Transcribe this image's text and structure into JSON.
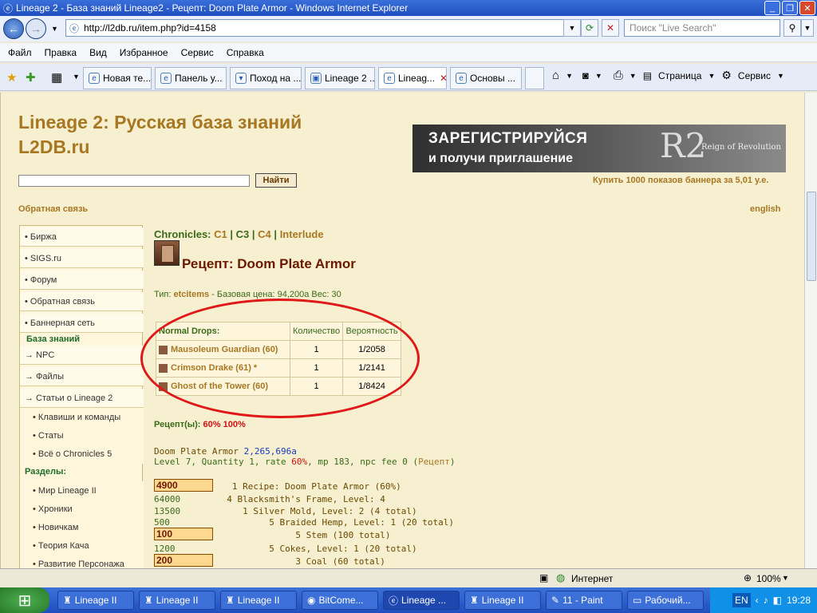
{
  "window": {
    "title": "Lineage 2 - База знаний Lineage2 - Рецепт: Doom Plate Armor - Windows Internet Explorer"
  },
  "address": {
    "url": "http://l2db.ru/item.php?id=4158",
    "search_placeholder": "Поиск \"Live Search\""
  },
  "menu": [
    "Файл",
    "Правка",
    "Вид",
    "Избранное",
    "Сервис",
    "Справка"
  ],
  "tabs": [
    "Новая те...",
    "Панель у...",
    "Поход на ...",
    "Lineage 2 ...",
    "Lineag...",
    "Основы ..."
  ],
  "commands": {
    "page": "Страница",
    "tools": "Сервис"
  },
  "site": {
    "title_line1": "Lineage 2: Русская база знаний",
    "title_line2": "L2DB.ru",
    "search_button": "Найти",
    "feedback": "Обратная связь",
    "english": "english",
    "banner_line1": "ЗАРЕГИСТРИРУЙСЯ",
    "banner_line2": "и получи приглашение",
    "banner_logo": "R2",
    "banner_logo_text": "Reign of Revolution",
    "buy_banner": "Купить 1000 показов баннера за 5,01 у.е."
  },
  "sidebar": {
    "top_items": [
      "• Биржа",
      "• SIGS.ru",
      "• Форум",
      "• Обратная связь",
      "• Баннерная сеть"
    ],
    "kb_heading": "База знаний",
    "kb_items": [
      "→  NPC",
      "→  Файлы",
      "→  Статьи о Lineage 2"
    ],
    "sub_items": [
      "• Клавиши и команды",
      "• Статы",
      "• Всё о Chronicles 5"
    ],
    "sections_heading": "Разделы:",
    "section_items": [
      "• Мир Lineage II",
      "• Хроники",
      "• Новичкам",
      "• Теория Кача",
      "• Развитие Персонажа"
    ]
  },
  "item": {
    "chronicles_label": "Chronicles:",
    "chronicles": [
      "C1",
      "C3",
      "C4",
      "Interlude"
    ],
    "chron_sep": "|",
    "title": "Рецепт: Doom Plate Armor",
    "type_label": "Тип:",
    "type_value": "etcitems",
    "price_label": "- Базовая цена: 94,200a",
    "weight": "Вес: 30",
    "drops_header": [
      "Normal Drops:",
      "Количество",
      "Вероятность"
    ],
    "drops": [
      {
        "name": "Mausoleum Guardian (60)",
        "qty": "1",
        "chance": "1/2058"
      },
      {
        "name": "Crimson Drake (61) *",
        "qty": "1",
        "chance": "1/2141"
      },
      {
        "name": "Ghost of the Tower (60)",
        "qty": "1",
        "chance": "1/8424"
      }
    ],
    "recipe_label": "Рецепт(ы):",
    "recipe_rate1": "60%",
    "recipe_rate2": "100%",
    "craft_line1_name": "Doom Plate Armor",
    "craft_line1_price": "2,265,696a",
    "craft_line2a": "Level 7, Quantity 1, rate",
    "craft_line2_rate": "60%",
    "craft_line2b": ", mp 183, npc fee 0 (",
    "craft_line2_link": "Рецепт",
    "craft_line2c": ")",
    "tree": [
      {
        "box": "4900",
        "text": "   1 Recipe: Doom Plate Armor (60%)"
      },
      {
        "qty": "64000",
        "text": "  4 Blacksmith's Frame, Level: 4"
      },
      {
        "qty": "13500",
        "text": "     1 Silver Mold, Level: 2 (4 total)"
      },
      {
        "qty": "500",
        "text": "          5 Braided Hemp, Level: 1 (20 total)"
      },
      {
        "box": "100",
        "text": "               5 Stem (100 total)"
      },
      {
        "qty": "1200",
        "text": "          5 Cokes, Level: 1 (20 total)"
      },
      {
        "box": "200",
        "text": "               3 Coal (60 total)"
      }
    ]
  },
  "status": {
    "zone": "Интернет",
    "zoom": "100%"
  },
  "taskbar": {
    "tasks": [
      "Lineage II",
      "Lineage II",
      "Lineage II",
      "BitCome...",
      "Lineage ...",
      "Lineage II",
      "11 - Paint",
      "Рабочий..."
    ],
    "lang": "EN",
    "time": "19:28"
  }
}
